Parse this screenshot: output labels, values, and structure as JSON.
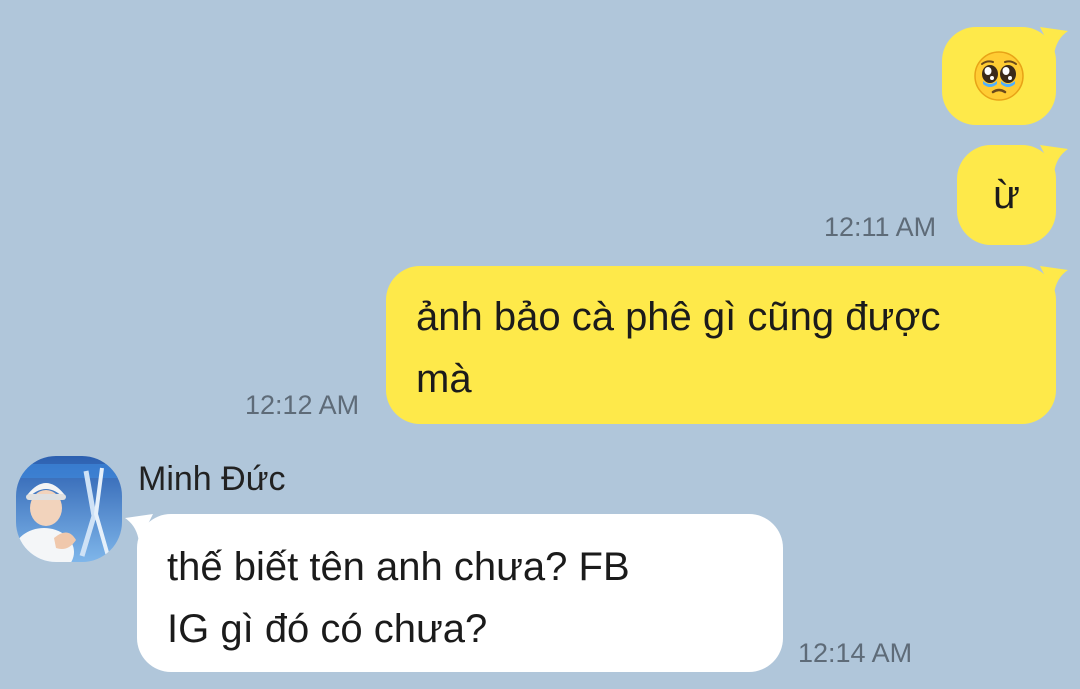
{
  "messages": [
    {
      "id": "m1",
      "sender": "me",
      "text": "🥺",
      "time": ""
    },
    {
      "id": "m2",
      "sender": "me",
      "text": "ừ",
      "time": "12:11 AM"
    },
    {
      "id": "m3",
      "sender": "me",
      "text": "ảnh bảo cà phê gì cũng được\nmà",
      "time": "12:12 AM"
    },
    {
      "id": "m4",
      "sender": "Minh Đức",
      "text": "thế biết tên anh chưa? FB\nIG gì đó có chưa?",
      "time": "12:14 AM"
    }
  ],
  "contact": {
    "name": "Minh Đức",
    "avatar_icon": "profile-photo"
  },
  "colors": {
    "background": "#b0c6da",
    "my_bubble": "#fee94a",
    "their_bubble": "#ffffff",
    "timestamp": "#5e6b78"
  }
}
